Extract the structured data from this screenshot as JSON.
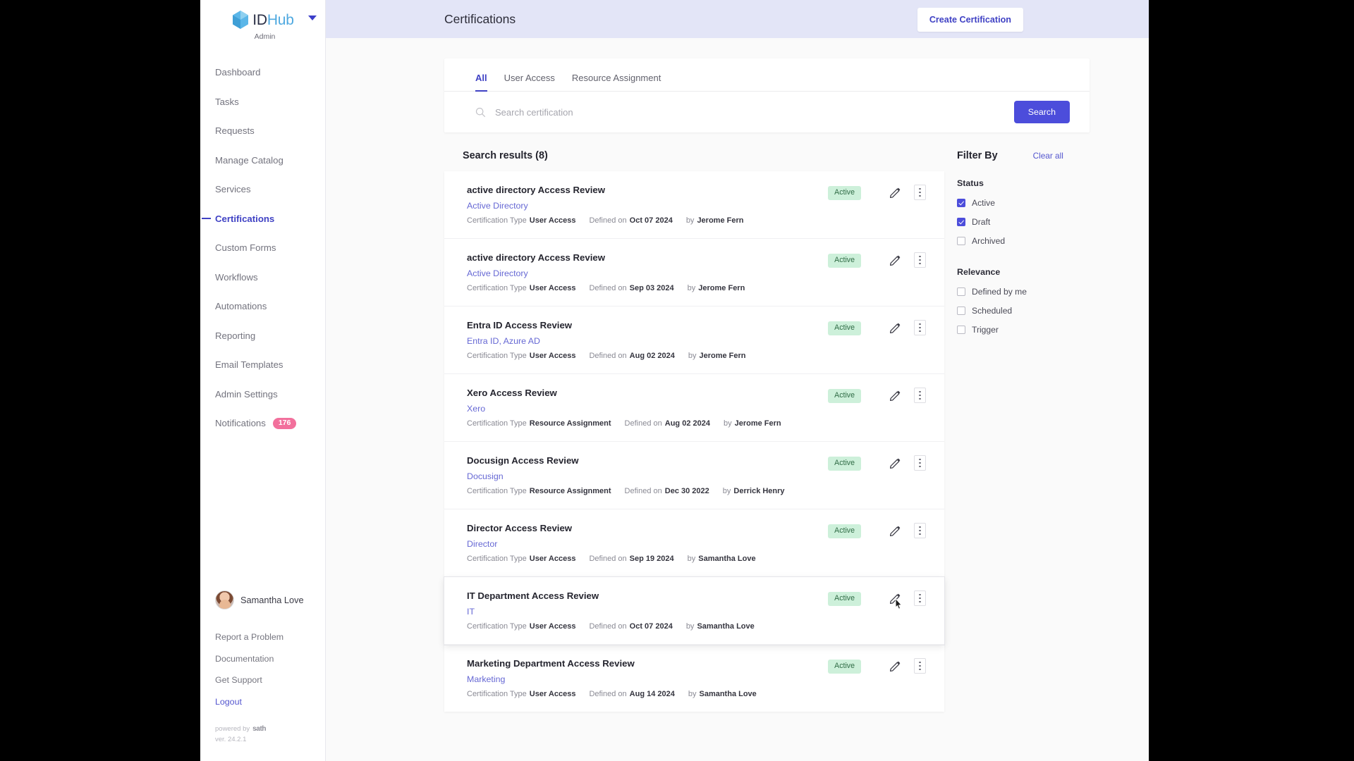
{
  "brand": {
    "logo_id": "ID",
    "logo_hub": "Hub",
    "role": "Admin",
    "accent": "#3f41c4",
    "logo_blue": "#4fa9e0"
  },
  "sidebar": {
    "items": [
      {
        "label": "Dashboard",
        "active": false
      },
      {
        "label": "Tasks",
        "active": false
      },
      {
        "label": "Requests",
        "active": false
      },
      {
        "label": "Manage Catalog",
        "active": false
      },
      {
        "label": "Services",
        "active": false
      },
      {
        "label": "Certifications",
        "active": true
      },
      {
        "label": "Custom Forms",
        "active": false
      },
      {
        "label": "Workflows",
        "active": false
      },
      {
        "label": "Automations",
        "active": false
      },
      {
        "label": "Reporting",
        "active": false
      },
      {
        "label": "Email Templates",
        "active": false
      },
      {
        "label": "Admin Settings",
        "active": false
      },
      {
        "label": "Notifications",
        "active": false,
        "badge": "176"
      }
    ],
    "user": {
      "name": "Samantha Love"
    },
    "footer_links": [
      {
        "label": "Report a Problem",
        "accent": false
      },
      {
        "label": "Documentation",
        "accent": false
      },
      {
        "label": "Get Support",
        "accent": false
      },
      {
        "label": "Logout",
        "accent": true
      }
    ],
    "powered_by": "powered by",
    "powered_brand": "sath",
    "version": "ver. 24.2.1"
  },
  "header": {
    "title": "Certifications",
    "create_button": "Create Certification"
  },
  "tabs": [
    {
      "label": "All",
      "active": true
    },
    {
      "label": "User Access",
      "active": false
    },
    {
      "label": "Resource Assignment",
      "active": false
    }
  ],
  "search": {
    "placeholder": "Search certification",
    "value": "",
    "button": "Search"
  },
  "results": {
    "heading": "Search results (8)",
    "meta_type_label": "Certification Type",
    "meta_defined_label": "Defined on",
    "meta_by_label": "by",
    "rows": [
      {
        "title": "active directory Access Review",
        "resource": "Active Directory",
        "cert_type": "User Access",
        "defined_on": "Oct 07 2024",
        "author": "Jerome Fern",
        "status": "Active",
        "hovered": false
      },
      {
        "title": "active directory Access Review",
        "resource": "Active Directory",
        "cert_type": "User Access",
        "defined_on": "Sep 03 2024",
        "author": "Jerome Fern",
        "status": "Active",
        "hovered": false
      },
      {
        "title": "Entra ID Access Review",
        "resource": "Entra ID, Azure AD",
        "cert_type": "User Access",
        "defined_on": "Aug 02 2024",
        "author": "Jerome Fern",
        "status": "Active",
        "hovered": false
      },
      {
        "title": "Xero Access Review",
        "resource": "Xero",
        "cert_type": "Resource Assignment",
        "defined_on": "Aug 02 2024",
        "author": "Jerome Fern",
        "status": "Active",
        "hovered": false
      },
      {
        "title": "Docusign Access Review",
        "resource": "Docusign",
        "cert_type": "Resource Assignment",
        "defined_on": "Dec 30 2022",
        "author": "Derrick Henry",
        "status": "Active",
        "hovered": false
      },
      {
        "title": "Director Access Review",
        "resource": "Director",
        "cert_type": "User Access",
        "defined_on": "Sep 19 2024",
        "author": "Samantha Love",
        "status": "Active",
        "hovered": false
      },
      {
        "title": "IT Department Access Review",
        "resource": "IT",
        "cert_type": "User Access",
        "defined_on": "Oct 07 2024",
        "author": "Samantha Love",
        "status": "Active",
        "hovered": true
      },
      {
        "title": "Marketing Department Access Review",
        "resource": "Marketing",
        "cert_type": "User Access",
        "defined_on": "Aug 14 2024",
        "author": "Samantha Love",
        "status": "Active",
        "hovered": false
      }
    ]
  },
  "filter": {
    "title": "Filter By",
    "clear_all": "Clear all",
    "groups": [
      {
        "title": "Status",
        "options": [
          {
            "label": "Active",
            "checked": true
          },
          {
            "label": "Draft",
            "checked": true
          },
          {
            "label": "Archived",
            "checked": false
          }
        ]
      },
      {
        "title": "Relevance",
        "options": [
          {
            "label": "Defined by me",
            "checked": false
          },
          {
            "label": "Scheduled",
            "checked": false
          },
          {
            "label": "Trigger",
            "checked": false
          }
        ]
      }
    ]
  }
}
